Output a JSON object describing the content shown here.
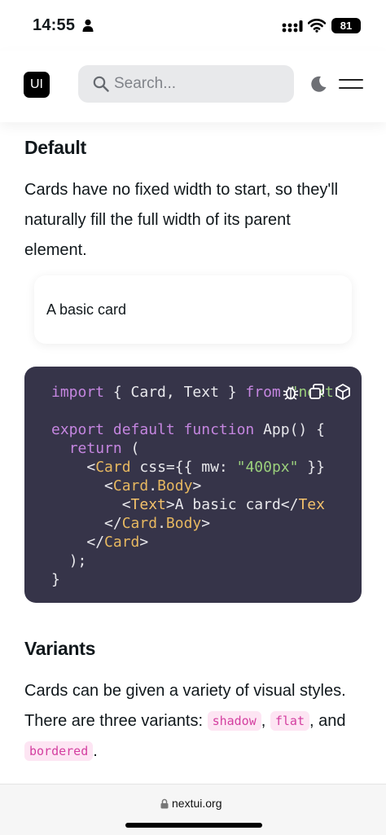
{
  "status_bar": {
    "time": "14:55",
    "battery": "81",
    "icons": [
      "person-icon",
      "signal-icon",
      "wifi-icon",
      "battery-icon"
    ]
  },
  "nav": {
    "logo": "UI",
    "search_placeholder": "Search...",
    "icons": [
      "search-icon",
      "moon-icon",
      "menu-icon"
    ]
  },
  "default_section": {
    "heading": "Default",
    "lines": [
      "Cards have no fixed width to start, so they'll",
      "naturally fill the full width of its parent",
      "element."
    ],
    "card_text": "A basic card"
  },
  "code_block": {
    "tools": [
      "bug-icon",
      "copy-icon",
      "cube-icon"
    ],
    "line1": {
      "kw": "import",
      "rest": " { Card, Text } ",
      "from": "from",
      "str": " \"next"
    },
    "line2": {
      "kw": "export default function",
      "rest": " App() {"
    },
    "line3": {
      "kw": "return",
      "rest": " ("
    },
    "line4": {
      "open": "<",
      "tag": "Card",
      "attr": " css={{ mw: ",
      "str": "\"400px\"",
      "close": " }}"
    },
    "line5": {
      "open": "<",
      "tag": "Card",
      "dot": ".",
      "tag2": "Body",
      "close": ">"
    },
    "line6": {
      "open": "<",
      "tag": "Text",
      "mid": ">A basic card</",
      "tag_end": "Tex"
    },
    "line7": {
      "open": "</",
      "tag": "Card",
      "dot": ".",
      "tag2": "Body",
      "close": ">"
    },
    "line8": {
      "open": "</",
      "tag": "Card",
      "close": ">"
    },
    "line9": ");",
    "line10": "}"
  },
  "variants_section": {
    "heading": "Variants",
    "line1": "Cards can be given a variety of visual styles.",
    "line2_prefix": "There are three variants: ",
    "variant1": "shadow",
    "sep1": ", ",
    "variant2": "flat",
    "sep2": ", and",
    "variant3": "bordered",
    "end": "."
  },
  "bottom_bar": {
    "url": "nextui.org"
  }
}
